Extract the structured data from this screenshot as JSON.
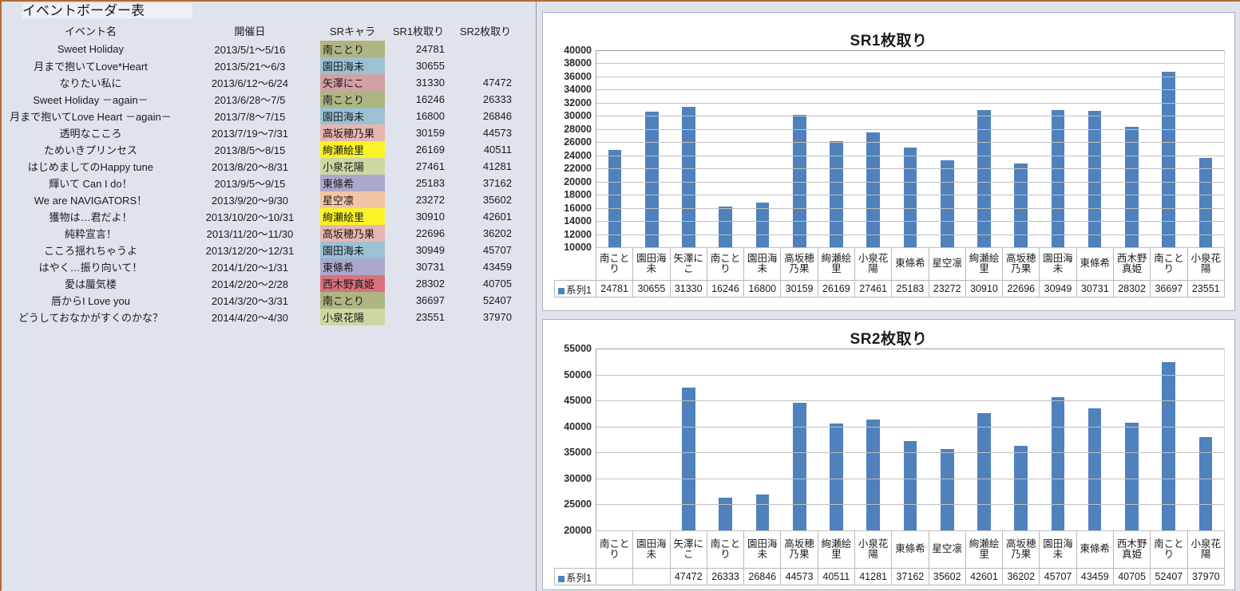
{
  "window": {
    "background_color": "#E0E3EC",
    "accent_border_color": "#B06A30"
  },
  "table": {
    "title": "イベントボーダー表",
    "headers": {
      "event": "イベント名",
      "date": "開催日",
      "chara": "SRキャラ",
      "sr1": "SR1枚取り",
      "sr2": "SR2枚取り"
    },
    "rows": [
      {
        "event": "Sweet Holiday",
        "date": "2013/5/1～5/16",
        "chara": "南ことり",
        "chara_color": "#AFB483",
        "sr1": "24781",
        "sr2": ""
      },
      {
        "event": "月まで抱いてLove*Heart",
        "date": "2013/5/21～6/3",
        "chara": "園田海未",
        "chara_color": "#9CC0D4",
        "sr1": "30655",
        "sr2": ""
      },
      {
        "event": "なりたい私に",
        "date": "2013/6/12～6/24",
        "chara": "矢澤にこ",
        "chara_color": "#D2A0A5",
        "sr1": "31330",
        "sr2": "47472"
      },
      {
        "event": "Sweet Holiday －again－",
        "date": "2013/6/28～7/5",
        "chara": "南ことり",
        "chara_color": "#AFB483",
        "sr1": "16246",
        "sr2": "26333"
      },
      {
        "event": "月まで抱いてLove Heart －again－",
        "date": "2013/7/8～7/15",
        "chara": "園田海未",
        "chara_color": "#9CC0D4",
        "sr1": "16800",
        "sr2": "26846"
      },
      {
        "event": "透明なこころ",
        "date": "2013/7/19～7/31",
        "chara": "高坂穂乃果",
        "chara_color": "#E7B5B0",
        "sr1": "30159",
        "sr2": "44573"
      },
      {
        "event": "ためいきプリンセス",
        "date": "2013/8/5～8/15",
        "chara": "絢瀬絵里",
        "chara_color": "#FAF327",
        "sr1": "26169",
        "sr2": "40511"
      },
      {
        "event": "はじめましてのHappy tune",
        "date": "2013/8/20～8/31",
        "chara": "小泉花陽",
        "chara_color": "#CBD8A2",
        "sr1": "27461",
        "sr2": "41281"
      },
      {
        "event": "輝いて  Can I do！",
        "date": "2013/9/5～9/15",
        "chara": "東條希",
        "chara_color": "#ABA8CB",
        "sr1": "25183",
        "sr2": "37162"
      },
      {
        "event": "We are NAVIGATORS！",
        "date": "2013/9/20～9/30",
        "chara": "星空凛",
        "chara_color": "#F2C5A4",
        "sr1": "23272",
        "sr2": "35602"
      },
      {
        "event": "獲物は…君だよ！",
        "date": "2013/10/20～10/31",
        "chara": "絢瀬絵里",
        "chara_color": "#FAF327",
        "sr1": "30910",
        "sr2": "42601"
      },
      {
        "event": "純粋宣言！",
        "date": "2013/11/20～11/30",
        "chara": "高坂穂乃果",
        "chara_color": "#E7B5B0",
        "sr1": "22696",
        "sr2": "36202"
      },
      {
        "event": "こころ揺れちゃうよ",
        "date": "2013/12/20～12/31",
        "chara": "園田海未",
        "chara_color": "#9CC0D4",
        "sr1": "30949",
        "sr2": "45707"
      },
      {
        "event": "はやく…振り向いて！",
        "date": "2014/1/20～1/31",
        "chara": "東條希",
        "chara_color": "#ABA8CB",
        "sr1": "30731",
        "sr2": "43459"
      },
      {
        "event": "愛は蜃気楼",
        "date": "2014/2/20～2/28",
        "chara": "西木野真姫",
        "chara_color": "#D9707C",
        "sr1": "28302",
        "sr2": "40705"
      },
      {
        "event": "唇からI Love you",
        "date": "2014/3/20～3/31",
        "chara": "南ことり",
        "chara_color": "#AFB483",
        "sr1": "36697",
        "sr2": "52407"
      },
      {
        "event": "どうしておなかがすくのかな？",
        "date": "2014/4/20～4/30",
        "chara": "小泉花陽",
        "chara_color": "#CBD8A2",
        "sr1": "23551",
        "sr2": "37970"
      }
    ]
  },
  "chart_data": [
    {
      "type": "bar",
      "title": "SR1枚取り",
      "xlabel": "",
      "ylabel": "",
      "ylim": [
        10000,
        40000
      ],
      "ytick_step": 2000,
      "yticks": [
        "40000",
        "38000",
        "36000",
        "34000",
        "32000",
        "30000",
        "28000",
        "26000",
        "24000",
        "22000",
        "20000",
        "18000",
        "16000",
        "14000",
        "12000",
        "10000"
      ],
      "grid": true,
      "legend": "系列1",
      "legend_position": "bottom-left",
      "bar_color": "#4F81BD",
      "categories": [
        "南ことり",
        "園田海未",
        "矢澤にこ",
        "南ことり",
        "園田海未",
        "高坂穂乃果",
        "絢瀬絵里",
        "小泉花陽",
        "東條希",
        "星空凛",
        "絢瀬絵里",
        "高坂穂乃果",
        "園田海未",
        "東條希",
        "西木野真姫",
        "南ことり",
        "小泉花陽"
      ],
      "values": [
        24781,
        30655,
        31330,
        16246,
        16800,
        30159,
        26169,
        27461,
        25183,
        23272,
        30910,
        22696,
        30949,
        30731,
        28302,
        36697,
        23551
      ],
      "value_labels": [
        "24781",
        "30655",
        "31330",
        "16246",
        "16800",
        "30159",
        "26169",
        "27461",
        "25183",
        "23272",
        "30910",
        "22696",
        "30949",
        "30731",
        "28302",
        "36697",
        "23551"
      ]
    },
    {
      "type": "bar",
      "title": "SR2枚取り",
      "xlabel": "",
      "ylabel": "",
      "ylim": [
        20000,
        55000
      ],
      "ytick_step": 5000,
      "yticks": [
        "55000",
        "50000",
        "45000",
        "40000",
        "35000",
        "30000",
        "25000",
        "20000"
      ],
      "grid": true,
      "legend": "系列1",
      "legend_position": "bottom-left",
      "bar_color": "#4F81BD",
      "categories": [
        "南ことり",
        "園田海未",
        "矢澤にこ",
        "南ことり",
        "園田海未",
        "高坂穂乃果",
        "絢瀬絵里",
        "小泉花陽",
        "東條希",
        "星空凛",
        "絢瀬絵里",
        "高坂穂乃果",
        "園田海未",
        "東條希",
        "西木野真姫",
        "南ことり",
        "小泉花陽"
      ],
      "values": [
        null,
        null,
        47472,
        26333,
        26846,
        44573,
        40511,
        41281,
        37162,
        35602,
        42601,
        36202,
        45707,
        43459,
        40705,
        52407,
        37970
      ],
      "value_labels": [
        "",
        "",
        "47472",
        "26333",
        "26846",
        "44573",
        "40511",
        "41281",
        "37162",
        "35602",
        "42601",
        "36202",
        "45707",
        "43459",
        "40705",
        "52407",
        "37970"
      ]
    }
  ]
}
